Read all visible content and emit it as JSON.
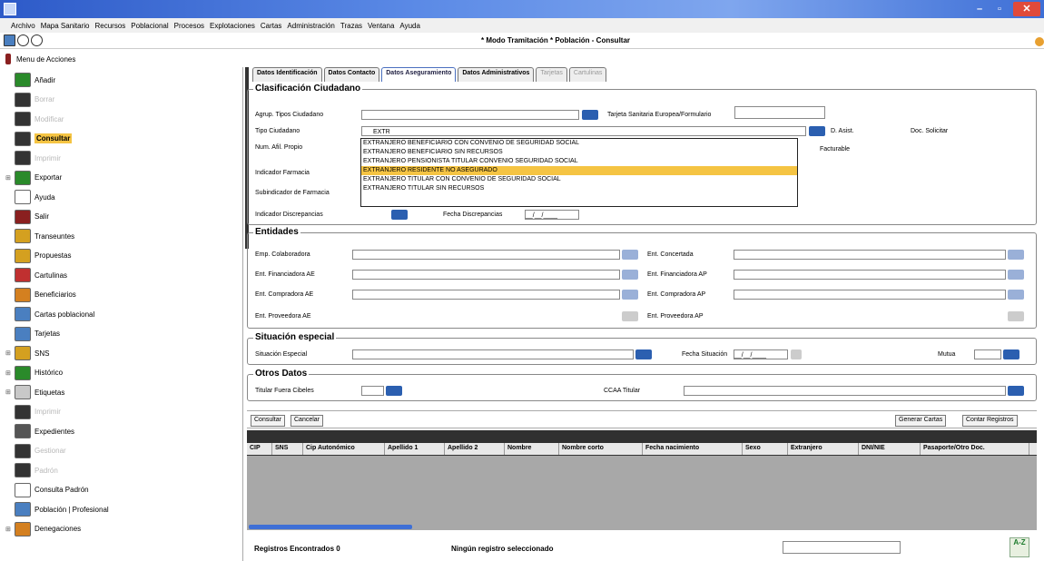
{
  "window": {
    "minimize": "–",
    "maximize": "▫",
    "close": "✕"
  },
  "menu": [
    "Archivo",
    "Mapa Sanitario",
    "Recursos",
    "Poblacional",
    "Procesos",
    "Explotaciones",
    "Cartas",
    "Administración",
    "Trazas",
    "Ventana",
    "Ayuda"
  ],
  "mode_title": "* Modo Tramitación *   Población - Consultar",
  "sidebar": {
    "header": "Menu de Acciones",
    "items": [
      {
        "label": "Añadir",
        "expander": "",
        "color": "#2a8a2a",
        "state": "normal"
      },
      {
        "label": "Borrar",
        "expander": "",
        "color": "#333333",
        "state": "dim"
      },
      {
        "label": "Modificar",
        "expander": "",
        "color": "#333333",
        "state": "dim"
      },
      {
        "label": "Consultar",
        "expander": "",
        "color": "#333333",
        "state": "highlight"
      },
      {
        "label": "Imprimir",
        "expander": "",
        "color": "#333333",
        "state": "dim"
      },
      {
        "label": "Exportar",
        "expander": "⊞",
        "color": "#2a8a2a",
        "state": "normal"
      },
      {
        "label": "Ayuda",
        "expander": "",
        "color": "#ffffff",
        "state": "normal"
      },
      {
        "label": "Salir",
        "expander": "",
        "color": "#8a2020",
        "state": "normal"
      },
      {
        "label": "Transeuntes",
        "expander": "",
        "color": "#d4a020",
        "state": "normal"
      },
      {
        "label": "Propuestas",
        "expander": "",
        "color": "#d4a020",
        "state": "normal"
      },
      {
        "label": "Cartulinas",
        "expander": "",
        "color": "#c03030",
        "state": "normal"
      },
      {
        "label": "Beneficiarios",
        "expander": "",
        "color": "#d48020",
        "state": "normal"
      },
      {
        "label": "Cartas poblacional",
        "expander": "",
        "color": "#4a7fc0",
        "state": "normal"
      },
      {
        "label": "Tarjetas",
        "expander": "",
        "color": "#4a7fc0",
        "state": "normal"
      },
      {
        "label": "SNS",
        "expander": "⊞",
        "color": "#d4a020",
        "state": "normal"
      },
      {
        "label": "Histórico",
        "expander": "⊞",
        "color": "#2a8a2a",
        "state": "normal"
      },
      {
        "label": "Etiquetas",
        "expander": "⊞",
        "color": "#c8c8c8",
        "state": "normal"
      },
      {
        "label": "Imprimir",
        "expander": "",
        "color": "#333333",
        "state": "dim"
      },
      {
        "label": "Expedientes",
        "expander": "",
        "color": "#555555",
        "state": "normal"
      },
      {
        "label": "Gestionar",
        "expander": "",
        "color": "#333333",
        "state": "dim"
      },
      {
        "label": "Padrón",
        "expander": "",
        "color": "#333333",
        "state": "dim"
      },
      {
        "label": "Consulta Padrón",
        "expander": "",
        "color": "#ffffff",
        "state": "normal"
      },
      {
        "label": "Población | Profesional",
        "expander": "",
        "color": "#4a7fc0",
        "state": "normal"
      },
      {
        "label": "Denegaciones",
        "expander": "⊞",
        "color": "#d48020",
        "state": "normal"
      }
    ]
  },
  "tabs": [
    {
      "label": "Datos Identificación",
      "state": "normal"
    },
    {
      "label": "Datos Contacto",
      "state": "normal"
    },
    {
      "label": "Datos Aseguramiento",
      "state": "active"
    },
    {
      "label": "Datos Administrativos",
      "state": "normal"
    },
    {
      "label": "Tarjetas",
      "state": "dim"
    },
    {
      "label": "Cartulinas",
      "state": "dim"
    }
  ],
  "clasificacion": {
    "title": "Clasificación Ciudadano",
    "agrup_label": "Agrup. Tipos Ciudadano",
    "tarjeta_label": "Tarjeta Sanitaria Europea/Formulario",
    "tipo_label": "Tipo Ciudadano",
    "tipo_value": "EXTR",
    "d_asist": "D. Asist.",
    "doc_solicitar": "Doc. Solicitar",
    "num_afil_label": "Num. Afil. Propio",
    "facturable": "Facturable",
    "ind_farmacia_label": "Indicador Farmacia",
    "subind_label": "Subindicador de Farmacia",
    "ind_discrep_label": "Indicador Discrepancias",
    "fecha_discrep_label": "Fecha Discrepancias",
    "fecha_discrep_value": "__/__/____"
  },
  "dropdown_options": [
    {
      "text": "EXTRANJERO BENEFICIARIO CON CONVENIO DE SEGURIDAD SOCIAL",
      "selected": false
    },
    {
      "text": "EXTRANJERO BENEFICIARIO SIN RECURSOS",
      "selected": false
    },
    {
      "text": "EXTRANJERO PENSIONISTA TITULAR CONVENIO SEGURIDAD SOCIAL",
      "selected": false
    },
    {
      "text": "EXTRANJERO RESIDENTE NO ASEGURADO",
      "selected": true
    },
    {
      "text": "EXTRANJERO TITULAR CON CONVENIO DE SEGURIDAD SOCIAL",
      "selected": false
    },
    {
      "text": "EXTRANJERO TITULAR SIN RECURSOS",
      "selected": false
    }
  ],
  "entidades": {
    "title": "Entidades",
    "emp_colab": "Emp. Colaboradora",
    "ent_concertada": "Ent. Concertada",
    "ent_fin_ae": "Ent. Financiadora AE",
    "ent_fin_ap": "Ent. Financiadora AP",
    "ent_comp_ae": "Ent. Compradora AE",
    "ent_comp_ap": "Ent. Compradora AP",
    "ent_prov_ae": "Ent. Proveedora AE",
    "ent_prov_ap": "Ent. Proveedora AP"
  },
  "situacion": {
    "title": "Situación especial",
    "sit_label": "Situación Especial",
    "fecha_label": "Fecha Situación",
    "fecha_value": "__/__/____",
    "mutua_label": "Mutua"
  },
  "otros": {
    "title": "Otros Datos",
    "titular_label": "Titular Fuera Cibeles",
    "ccaa_label": "CCAA Titular"
  },
  "buttons": {
    "consultar": "Consultar",
    "cancelar": "Cancelar",
    "generar": "Generar Cartas",
    "contar": "Contar Registros"
  },
  "grid_columns": [
    "CIP",
    "SNS",
    "Cip Autonómico",
    "Apellido 1",
    "Apellido 2",
    "Nombre",
    "Nombre corto",
    "Fecha nacimiento",
    "Sexo",
    "Extranjero",
    "DNI/NIE",
    "Pasaporte/Otro Doc."
  ],
  "status": {
    "registros": "Registros Encontrados 0",
    "seleccion": "Ningún registro seleccionado",
    "az": "A-Z"
  }
}
